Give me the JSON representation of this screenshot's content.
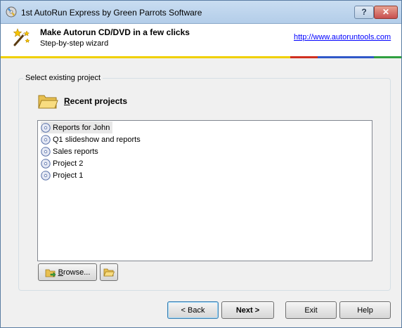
{
  "window": {
    "title": "1st AutoRun Express by Green Parrots Software"
  },
  "titlebar_buttons": {
    "help": "?",
    "close": "✕"
  },
  "header": {
    "title": "Make Autorun CD/DVD in a few clicks",
    "subtitle": "Step-by-step wizard",
    "link": "http://www.autoruntools.com"
  },
  "colors": {
    "bar": [
      "#f0d000",
      "#d03020",
      "#3058c8",
      "#30a040"
    ],
    "accent": "#3c7fb1"
  },
  "group": {
    "legend": "Select existing project"
  },
  "recent": {
    "label_first": "R",
    "label_rest": "ecent projects",
    "items": [
      {
        "label": "Reports for John",
        "icon": "cd-project-icon",
        "selected": true
      },
      {
        "label": "Q1 slideshow and reports",
        "icon": "cd-project-icon"
      },
      {
        "label": "Sales reports",
        "icon": "cd-project-icon"
      },
      {
        "label": "Project 2",
        "icon": "cd-project-icon"
      },
      {
        "label": "Project 1",
        "icon": "cd-project-icon"
      }
    ]
  },
  "buttons": {
    "browse_first": "B",
    "browse_rest": "rowse...",
    "back": "< Back",
    "next": "Next >",
    "exit": "Exit",
    "help": "Help"
  }
}
